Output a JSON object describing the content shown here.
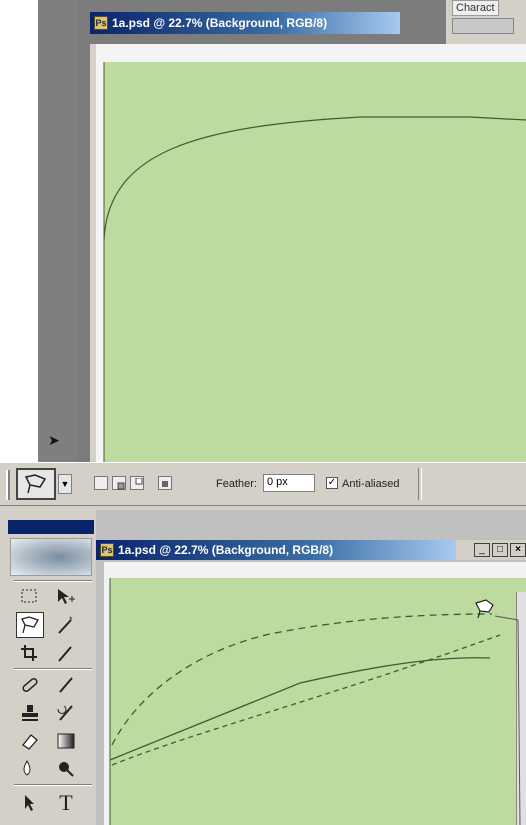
{
  "top_window": {
    "title": "1a.psd @ 22.7% (Background, RGB/8)",
    "partial_panel_label": "Charact"
  },
  "options_bar": {
    "feather_label": "Feather:",
    "feather_value": "0 px",
    "antialias_label": "Anti-aliased",
    "antialias_checked": true,
    "icons": [
      "polygonal-lasso-icon",
      "new-selection-icon",
      "add-to-selection-icon",
      "subtract-from-selection-icon",
      "intersect-selection-icon"
    ]
  },
  "bottom_window": {
    "title": "1a.psd @ 22.7% (Background, RGB/8)",
    "controls": [
      "_",
      "□",
      "×"
    ]
  },
  "toolbox": {
    "tools": [
      "marquee-icon",
      "move-icon",
      "polygonal-lasso-icon",
      "magic-wand-icon",
      "crop-icon",
      "slice-icon",
      "healing-brush-icon",
      "brush-icon",
      "clone-stamp-icon",
      "history-brush-icon",
      "eraser-icon",
      "gradient-icon",
      "blur-icon",
      "dodge-icon",
      "path-selection-icon",
      "type-icon"
    ],
    "type_tool_glyph": "T"
  },
  "colors": {
    "canvas_green": "#bddb9e",
    "window_title_blue": "#0a246a",
    "ui_gray": "#d4d0c8"
  }
}
